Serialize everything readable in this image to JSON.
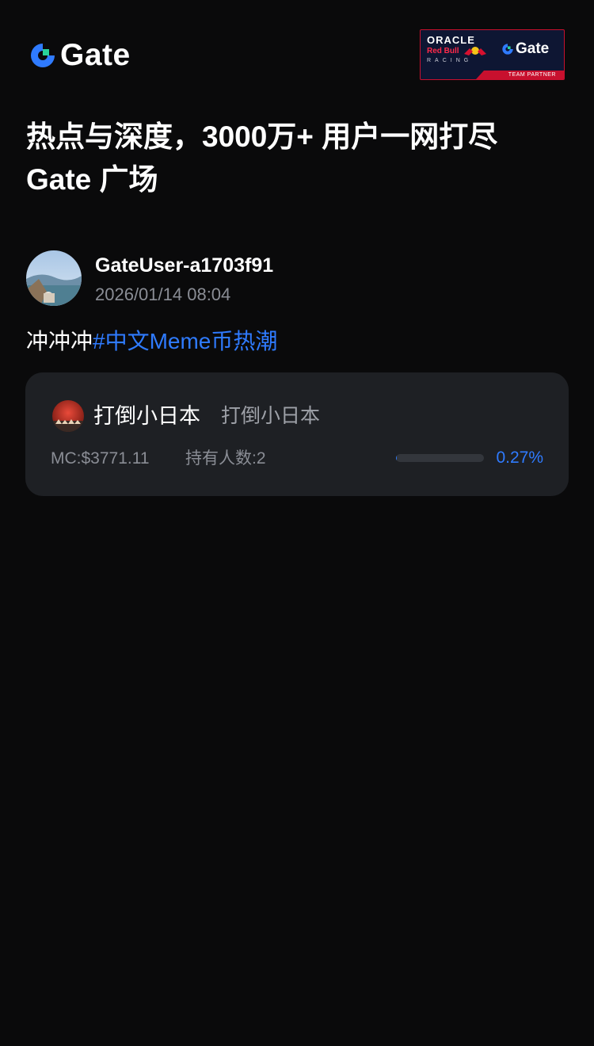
{
  "brand": {
    "logo_text": "Gate",
    "accent_color": "#2f7bff",
    "partner_badge": {
      "oracle": "ORACLE",
      "redbull": "Red Bull",
      "racing": "RACING",
      "gate": "Gate",
      "tagline": "TEAM PARTNER"
    }
  },
  "headline": {
    "line1": "热点与深度，3000万+ 用户一网打尽",
    "line2": "Gate 广场"
  },
  "post": {
    "username": "GateUser-a1703f91",
    "timestamp": "2026/01/14 08:04",
    "text": "冲冲冲",
    "hashtag": "#中文Meme币热潮",
    "token_card": {
      "name": "打倒小日本",
      "full_name": "打倒小日本",
      "market_cap": "MC:$3771.11",
      "holders": "持有人数:2",
      "progress_percent": 0.27,
      "progress_label": "0.27%"
    }
  }
}
